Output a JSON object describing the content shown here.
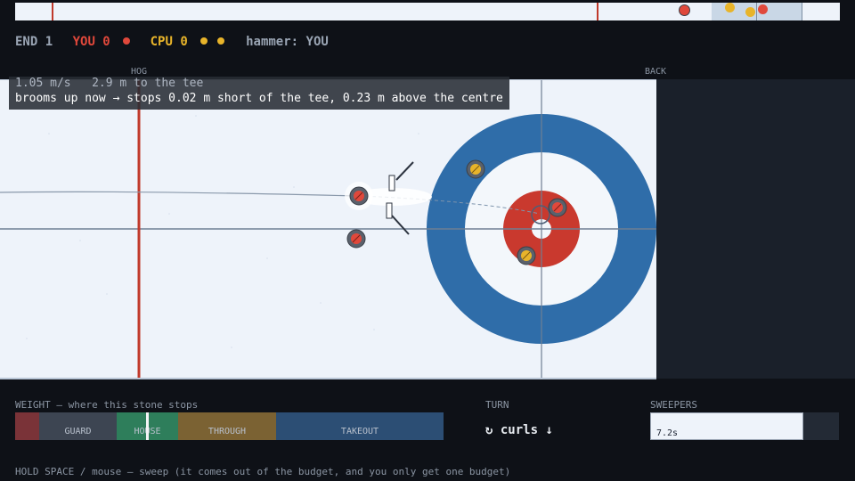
{
  "status": {
    "end_label": "END 1",
    "you_label": "YOU 0",
    "cpu_label": "CPU 0",
    "hammer_label": "hammer: YOU"
  },
  "sheet_labels": {
    "hog": "HOG",
    "back": "BACK"
  },
  "shot_info": {
    "line1": "1.05 m/s   2.9 m to the tee",
    "line2": "brooms up now → stops 0.02 m short of the tee, 0.23 m above the centre"
  },
  "weight": {
    "title": "WEIGHT — where this stone stops",
    "segments": [
      "GUARD",
      "HOUSE",
      "THROUGH",
      "TAKEOUT"
    ]
  },
  "turn": {
    "title": "TURN",
    "value": "↻ curls ↓"
  },
  "sweepers": {
    "title": "SWEEPERS",
    "time": "7.2s",
    "remaining_fraction": 0.81
  },
  "footer_hint": "HOLD SPACE / mouse — sweep (it comes out of the budget, and you only get one budget)",
  "colors": {
    "you": "#e0483b",
    "cpu": "#e8b42a",
    "house_outer": "#2f6da9",
    "house_button": "#c9392e",
    "hog_line": "#c0392b"
  },
  "icons": {
    "you_stone": "red-stone-icon",
    "cpu_stone": "yellow-stone-icon",
    "broom": "broom-icon"
  }
}
